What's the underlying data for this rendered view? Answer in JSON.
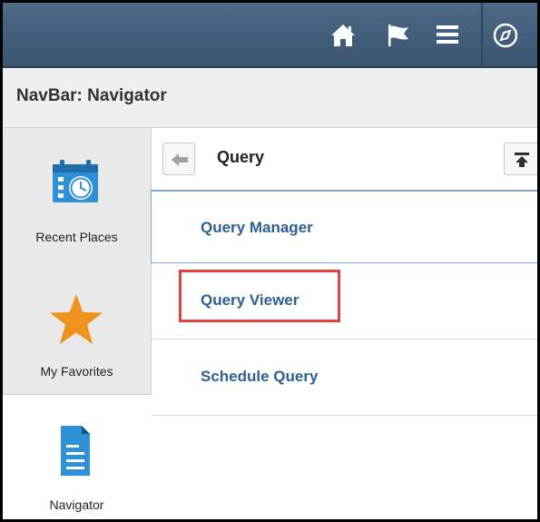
{
  "navbar": {
    "title": "NavBar: Navigator",
    "icons": [
      "home-icon",
      "flag-icon",
      "menu-icon",
      "compass-icon"
    ]
  },
  "sidebar": {
    "items": [
      {
        "label": "Recent Places",
        "icon": "calendar-clock-icon"
      },
      {
        "label": "My Favorites",
        "icon": "star-icon"
      },
      {
        "label": "Navigator",
        "icon": "document-icon"
      }
    ]
  },
  "main": {
    "header": {
      "title": "Query"
    },
    "items": [
      {
        "label": "Query Manager"
      },
      {
        "label": "Query Viewer"
      },
      {
        "label": "Schedule Query"
      }
    ]
  },
  "colors": {
    "topbar": "#3b5571",
    "link": "#2d5f93",
    "highlight": "#e0443f",
    "star": "#f0931e",
    "icon_blue": "#2e90d6"
  }
}
